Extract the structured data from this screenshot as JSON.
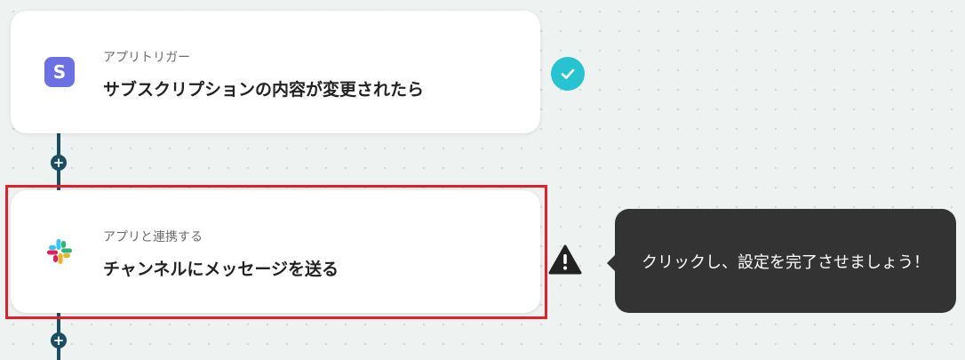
{
  "flow": {
    "trigger": {
      "icon": "stripe-icon",
      "icon_letter": "S",
      "label": "アプリトリガー",
      "title": "サブスクリプションの内容が変更されたら",
      "status": "completed"
    },
    "action": {
      "icon": "slack-icon",
      "label": "アプリと連携する",
      "title": "チャンネルにメッセージを送る",
      "status": "warning"
    },
    "add_step_symbol": "+"
  },
  "tooltip": {
    "text": "クリックし、設定を完了させましょう！"
  },
  "colors": {
    "highlight": "#e0202a",
    "connector": "#1b4e62",
    "check": "#27c3d3",
    "stripe": "#6b71e3",
    "tooltip_bg": "#333333"
  }
}
